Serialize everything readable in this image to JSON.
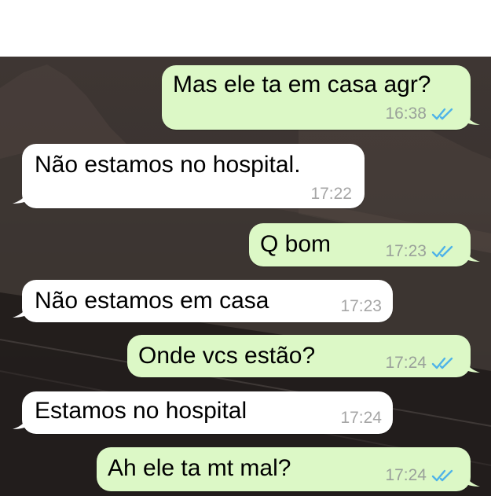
{
  "colors": {
    "outgoing_bubble": "#dcf8c6",
    "incoming_bubble": "#ffffff",
    "read_ticks": "#4fb3e8",
    "timestamp": "#9aa19a"
  },
  "messages": [
    {
      "direction": "out",
      "text": "Mas ele ta em casa agr?",
      "time": "16:38",
      "status_icon": "double-check-read-icon"
    },
    {
      "direction": "in",
      "text": "Não estamos no hospital.",
      "time": "17:22"
    },
    {
      "direction": "out",
      "text": "Q bom",
      "time": "17:23",
      "status_icon": "double-check-read-icon"
    },
    {
      "direction": "in",
      "text": "Não estamos em casa",
      "time": "17:23"
    },
    {
      "direction": "out",
      "text": "Onde vcs estão?",
      "time": "17:24",
      "status_icon": "double-check-read-icon"
    },
    {
      "direction": "in",
      "text": "Estamos no hospital",
      "time": "17:24"
    },
    {
      "direction": "out",
      "text": "Ah ele ta mt mal?",
      "time": "17:24",
      "status_icon": "double-check-read-icon"
    }
  ]
}
